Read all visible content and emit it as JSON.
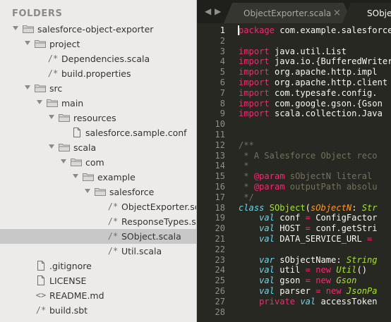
{
  "sidebar": {
    "header": "FOLDERS",
    "rows": [
      {
        "label": "salesforce-object-exporter",
        "type": "folder",
        "depth": 0,
        "open": true
      },
      {
        "label": "project",
        "type": "folder",
        "depth": 1,
        "open": true
      },
      {
        "label": "Dependencies.scala",
        "type": "file",
        "icon": "/*",
        "depth": 2
      },
      {
        "label": "build.properties",
        "type": "file",
        "icon": "/*",
        "depth": 2
      },
      {
        "label": "src",
        "type": "folder",
        "depth": 1,
        "open": true
      },
      {
        "label": "main",
        "type": "folder",
        "depth": 2,
        "open": true
      },
      {
        "label": "resources",
        "type": "folder",
        "depth": 3,
        "open": true
      },
      {
        "label": "salesforce.sample.conf",
        "type": "file",
        "icon": "doc",
        "depth": 4
      },
      {
        "label": "scala",
        "type": "folder",
        "depth": 3,
        "open": true
      },
      {
        "label": "com",
        "type": "folder",
        "depth": 4,
        "open": true
      },
      {
        "label": "example",
        "type": "folder",
        "depth": 5,
        "open": true
      },
      {
        "label": "salesforce",
        "type": "folder",
        "depth": 6,
        "open": true
      },
      {
        "label": "ObjectExporter.scala",
        "type": "file",
        "icon": "/*",
        "depth": 7
      },
      {
        "label": "ResponseTypes.scala",
        "type": "file",
        "icon": "/*",
        "depth": 7
      },
      {
        "label": "SObject.scala",
        "type": "file",
        "icon": "/*",
        "depth": 7,
        "selected": true
      },
      {
        "label": "Util.scala",
        "type": "file",
        "icon": "/*",
        "depth": 7
      },
      {
        "label": ".gitignore",
        "type": "file",
        "icon": "doc",
        "depth": 1
      },
      {
        "label": "LICENSE",
        "type": "file",
        "icon": "doc",
        "depth": 1
      },
      {
        "label": "README.md",
        "type": "file",
        "icon": "<>",
        "depth": 1
      },
      {
        "label": "build.sbt",
        "type": "file",
        "icon": "/*",
        "depth": 1
      }
    ]
  },
  "tabs": {
    "back_arrow": "◀",
    "forward_arrow": "▶",
    "items": [
      {
        "label": "ObjectExporter.scala",
        "active": false,
        "close": "×"
      },
      {
        "label": "SObject.scala",
        "active": true
      }
    ]
  },
  "editor": {
    "active_line": 1,
    "lines": [
      [
        {
          "t": "package",
          "c": "kw"
        },
        {
          "t": " com.example.salesforce"
        }
      ],
      [],
      [
        {
          "t": "import",
          "c": "kw"
        },
        {
          "t": " java.util.List"
        }
      ],
      [
        {
          "t": "import",
          "c": "kw"
        },
        {
          "t": " java.io.{BufferedWriter"
        }
      ],
      [
        {
          "t": "import",
          "c": "kw"
        },
        {
          "t": " org.apache.http.impl"
        }
      ],
      [
        {
          "t": "import",
          "c": "kw"
        },
        {
          "t": " org.apache.http.client"
        }
      ],
      [
        {
          "t": "import",
          "c": "kw"
        },
        {
          "t": " com.typesafe.config."
        }
      ],
      [
        {
          "t": "import",
          "c": "kw"
        },
        {
          "t": " com.google.gson.{Gson"
        }
      ],
      [
        {
          "t": "import",
          "c": "kw"
        },
        {
          "t": " scala.collection.Java"
        }
      ],
      [],
      [],
      [
        {
          "t": "/**",
          "c": "cm"
        }
      ],
      [
        {
          "t": " * A Salesforce Object reco",
          "c": "cm"
        }
      ],
      [
        {
          "t": " *",
          "c": "cm"
        }
      ],
      [
        {
          "t": " * ",
          "c": "cm"
        },
        {
          "t": "@param",
          "c": "kw"
        },
        {
          "t": " sObjectN literal",
          "c": "cm"
        }
      ],
      [
        {
          "t": " * ",
          "c": "cm"
        },
        {
          "t": "@param",
          "c": "kw"
        },
        {
          "t": " outputPath absolu",
          "c": "cm"
        }
      ],
      [
        {
          "t": " */",
          "c": "cm"
        }
      ],
      [
        {
          "t": "class",
          "c": "stype"
        },
        {
          "t": " "
        },
        {
          "t": "SObject",
          "c": "cls"
        },
        {
          "t": "("
        },
        {
          "t": "sObjectN",
          "c": "prm"
        },
        {
          "t": ": "
        },
        {
          "t": "Str",
          "c": "cls-i"
        }
      ],
      [
        {
          "t": "    "
        },
        {
          "t": "val",
          "c": "stype"
        },
        {
          "t": " conf "
        },
        {
          "t": "=",
          "c": "kw"
        },
        {
          "t": " ConfigFactor"
        }
      ],
      [
        {
          "t": "    "
        },
        {
          "t": "val",
          "c": "stype"
        },
        {
          "t": " HOST "
        },
        {
          "t": "=",
          "c": "kw"
        },
        {
          "t": " conf.getStri"
        }
      ],
      [
        {
          "t": "    "
        },
        {
          "t": "val",
          "c": "stype"
        },
        {
          "t": " DATA_SERVICE_URL "
        },
        {
          "t": "=",
          "c": "kw"
        }
      ],
      [],
      [
        {
          "t": "    "
        },
        {
          "t": "var",
          "c": "stype"
        },
        {
          "t": " sObjectName: "
        },
        {
          "t": "String",
          "c": "cls-i"
        }
      ],
      [
        {
          "t": "    "
        },
        {
          "t": "val",
          "c": "stype"
        },
        {
          "t": " util "
        },
        {
          "t": "=",
          "c": "kw"
        },
        {
          "t": " "
        },
        {
          "t": "new",
          "c": "kw"
        },
        {
          "t": " "
        },
        {
          "t": "Util",
          "c": "cls-i"
        },
        {
          "t": "()"
        }
      ],
      [
        {
          "t": "    "
        },
        {
          "t": "val",
          "c": "stype"
        },
        {
          "t": " gson "
        },
        {
          "t": "=",
          "c": "kw"
        },
        {
          "t": " "
        },
        {
          "t": "new",
          "c": "kw"
        },
        {
          "t": " "
        },
        {
          "t": "Gson",
          "c": "cls-i"
        }
      ],
      [
        {
          "t": "    "
        },
        {
          "t": "val",
          "c": "stype"
        },
        {
          "t": " parser "
        },
        {
          "t": "=",
          "c": "kw"
        },
        {
          "t": " "
        },
        {
          "t": "new",
          "c": "kw"
        },
        {
          "t": " "
        },
        {
          "t": "JsonPa",
          "c": "cls-i"
        }
      ],
      [
        {
          "t": "    "
        },
        {
          "t": "private",
          "c": "kw"
        },
        {
          "t": " "
        },
        {
          "t": "val",
          "c": "stype"
        },
        {
          "t": " accessToken"
        }
      ],
      []
    ]
  }
}
